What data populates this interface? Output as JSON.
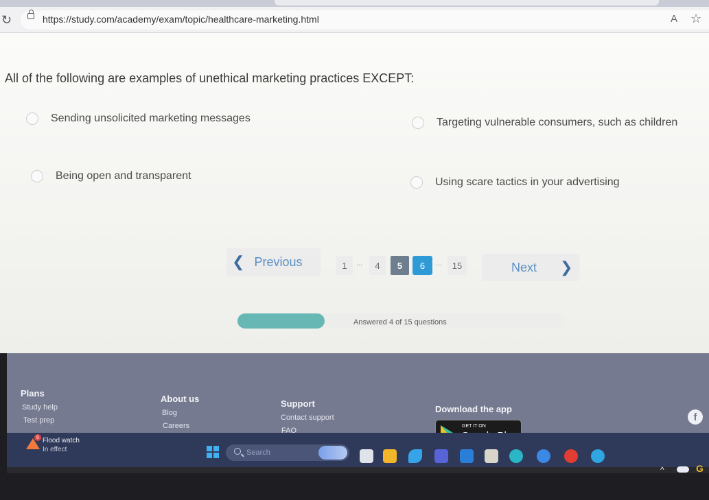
{
  "browser": {
    "url": "https://study.com/academy/exam/topic/healthcare-marketing.html",
    "reload_icon": "reload-icon",
    "read_aloud_label": "A",
    "favorite_icon": "star-icon"
  },
  "quiz": {
    "question": "All of the following are examples of unethical marketing practices EXCEPT:",
    "options": [
      {
        "label": "Sending unsolicited marketing messages"
      },
      {
        "label": "Targeting vulnerable consumers, such as children"
      },
      {
        "label": "Being open and transparent"
      },
      {
        "label": "Using scare tactics in your advertising"
      }
    ]
  },
  "pagination": {
    "previous_label": "Previous",
    "next_label": "Next",
    "pages": [
      "1",
      "4",
      "5",
      "6",
      "15"
    ],
    "ellipsis": "...",
    "current_page": "5",
    "hover_page": "6"
  },
  "progress": {
    "text": "Answered 4 of 15 questions",
    "answered": 4,
    "total": 15,
    "color": "#67b7b4"
  },
  "footer": {
    "plans": "Plans",
    "study_help": "Study help",
    "test_prep": "Test prep",
    "about_us": "About us",
    "blog": "Blog",
    "careers": "Careers",
    "support": "Support",
    "contact_support": "Contact support",
    "faq": "FAQ",
    "download_app": "Download the app",
    "get_it_on": "GET IT ON",
    "google_play": "Google Play",
    "facebook_glyph": "f"
  },
  "taskbar": {
    "weather_badge": "5",
    "weather_line1": "Flood watch",
    "weather_line2": "In effect",
    "search_placeholder": "Search",
    "tray_chevron": "^"
  }
}
